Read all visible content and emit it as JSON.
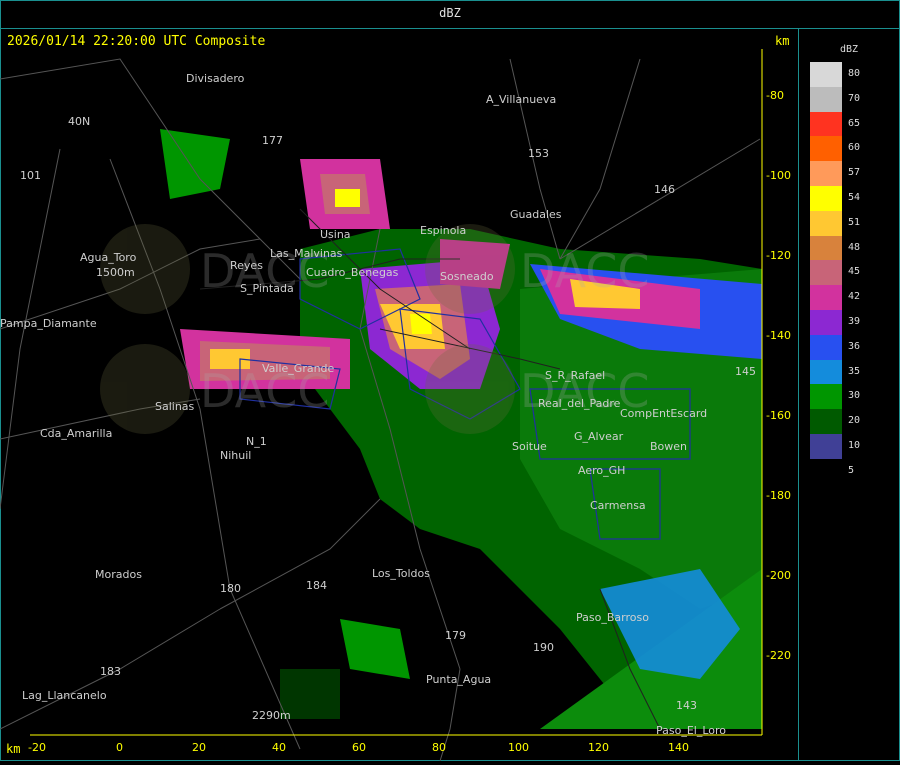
{
  "window": {
    "title": "dBZ"
  },
  "map": {
    "timestamp": "2026/01/14 22:20:00 UTC Composite",
    "unit_top": "km",
    "unit_bottom": "km",
    "x_ticks": [
      "-20",
      "0",
      "20",
      "40",
      "60",
      "80",
      "100",
      "120",
      "140"
    ],
    "y_ticks": [
      "-80",
      "-100",
      "-120",
      "-140",
      "-160",
      "-180",
      "-200",
      "-220"
    ],
    "places": [
      "Divisadero",
      "A_Villanueva",
      "Guadales",
      "Agua_Toro",
      "Reyes",
      "S_Pintada",
      "Pampa_Diamante",
      "Salinas",
      "Cda_Amarilla",
      "N_1",
      "Nihuil",
      "Morados",
      "Los_Toldos",
      "Punta_Agua",
      "Lag_Llancanelo",
      "Paso_Barroso",
      "Paso_El_Loro",
      "Soitue",
      "Aero_GH",
      "Bowen",
      "Carmensa",
      "CompEntEscard",
      "Valle_Grande",
      "S_R_Rafael",
      "Real_del_Padre",
      "G_Alvear",
      "Las_Malvinas",
      "Cuadro_Benegas",
      "Sosneado",
      "Usina",
      "Espinola",
      "2290m",
      "1500m",
      "40N",
      "101",
      "153",
      "146",
      "184",
      "180",
      "179",
      "183",
      "190",
      "143",
      "145",
      "177"
    ],
    "watermark": "DACC",
    "colors": {
      "accent": "#ffff00",
      "frame": "#1a8f8f"
    }
  },
  "legend": {
    "title": "dBZ",
    "levels": [
      {
        "label": "80",
        "color": "#d8d8d8"
      },
      {
        "label": "70",
        "color": "#bcbcbc"
      },
      {
        "label": "65",
        "color": "#ff3320"
      },
      {
        "label": "60",
        "color": "#ff6000"
      },
      {
        "label": "57",
        "color": "#ff9a5a"
      },
      {
        "label": "54",
        "color": "#ffff00"
      },
      {
        "label": "51",
        "color": "#ffc832"
      },
      {
        "label": "48",
        "color": "#d8823c"
      },
      {
        "label": "45",
        "color": "#c86478"
      },
      {
        "label": "42",
        "color": "#d2329e"
      },
      {
        "label": "39",
        "color": "#8c28d2"
      },
      {
        "label": "36",
        "color": "#2850f0"
      },
      {
        "label": "35",
        "color": "#148cdc"
      },
      {
        "label": "30",
        "color": "#009600"
      },
      {
        "label": "20",
        "color": "#005a00"
      },
      {
        "label": "10",
        "color": "#404096"
      },
      {
        "label": "5",
        "color": "#404096"
      }
    ]
  }
}
